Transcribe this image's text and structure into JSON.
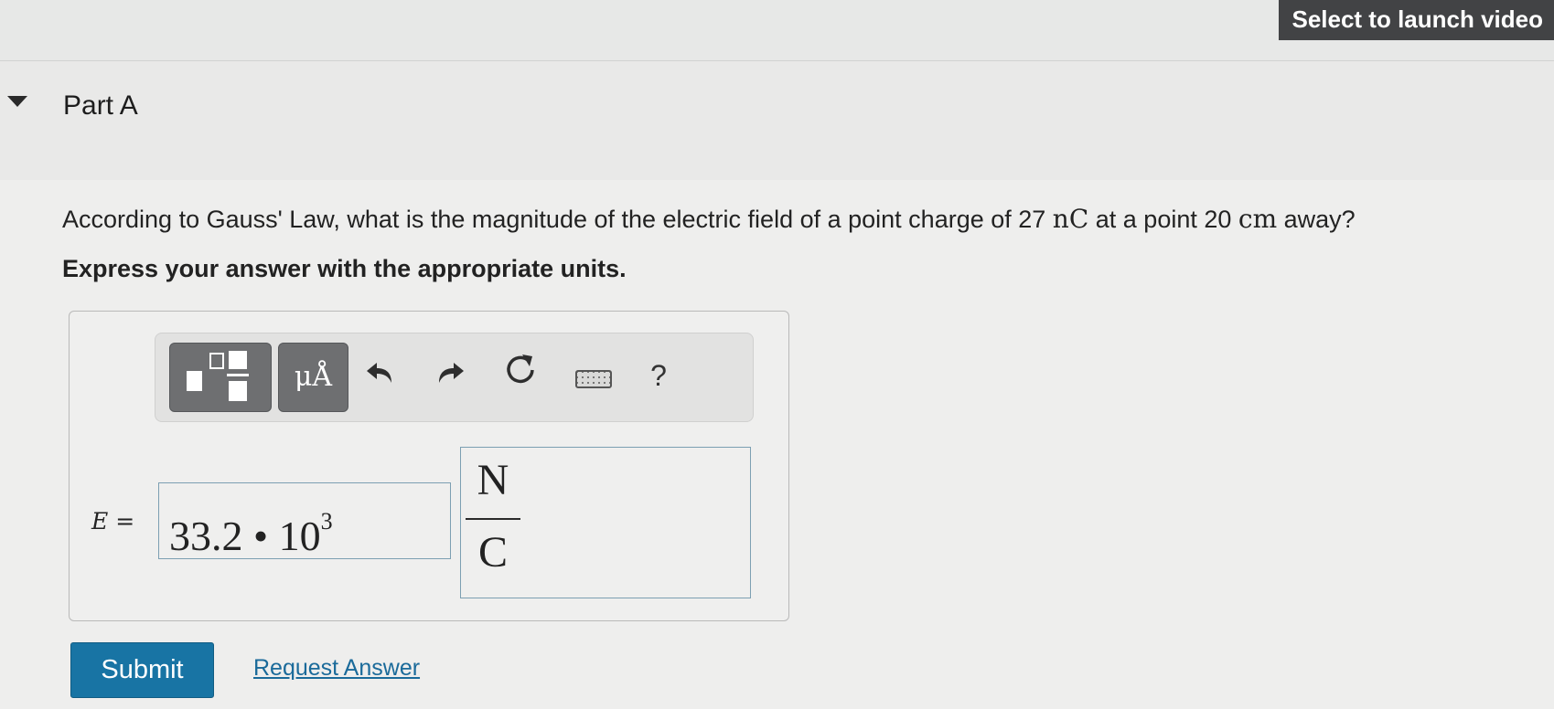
{
  "top_bar": {
    "video_button_label": "Select to launch video"
  },
  "part": {
    "title": "Part A"
  },
  "question": {
    "text_1": "According to Gauss' Law, what is the magnitude of the electric field of a point charge of 27 ",
    "charge_unit": "nC",
    "text_2": " at a point 20 ",
    "distance_unit": "cm",
    "text_3": " away?",
    "instruction": "Express your answer with the appropriate units."
  },
  "toolbar": {
    "templates_icon": "templates-icon",
    "units_label": "μÅ",
    "undo_icon": "undo-arrow-icon",
    "redo_icon": "redo-arrow-icon",
    "reset_icon": "reset-icon",
    "keyboard_icon": "keyboard-icon",
    "help_label": "?"
  },
  "answer": {
    "variable": "E",
    "equals": "=",
    "mantissa": "33.2",
    "operator": "•",
    "base": "10",
    "exponent": "3",
    "unit_numerator": "N",
    "unit_denominator": "C"
  },
  "actions": {
    "submit_label": "Submit",
    "request_answer_label": "Request Answer"
  },
  "colors": {
    "submit_bg": "#1874a4",
    "link": "#1a6a9a",
    "toolbar_button": "#6e6f71",
    "video_button": "#424345"
  }
}
